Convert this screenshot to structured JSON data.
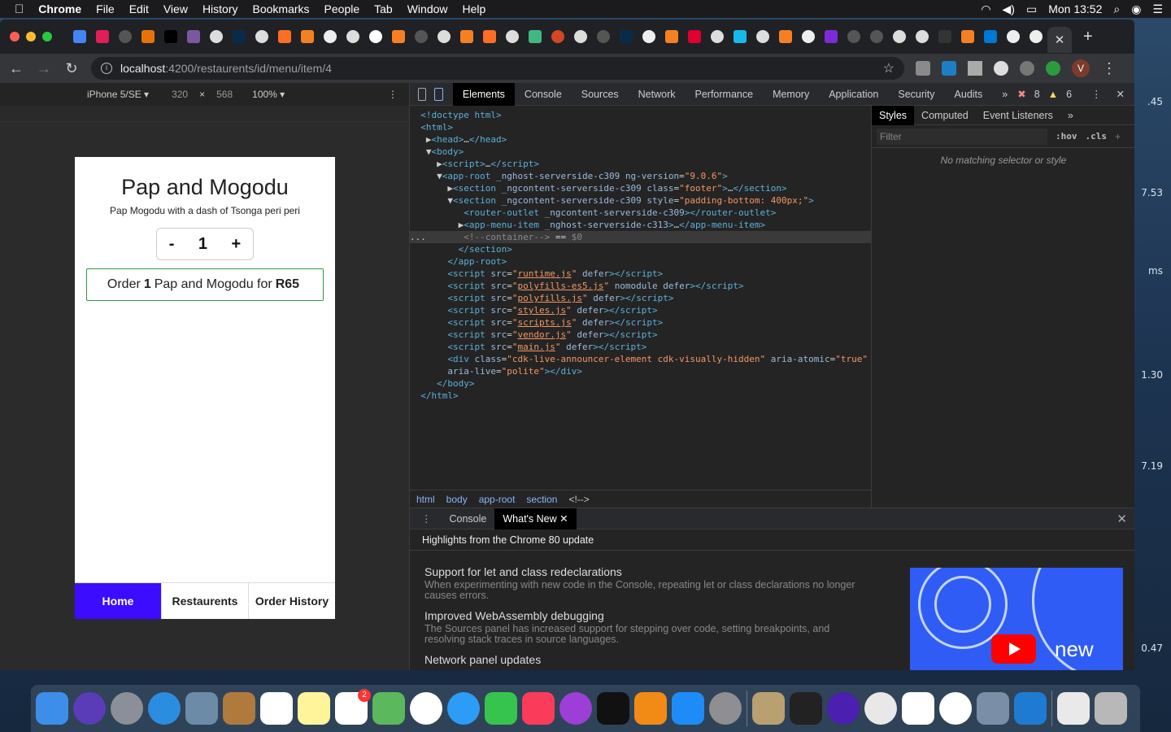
{
  "menubar": {
    "app": "Chrome",
    "menus": [
      "File",
      "Edit",
      "View",
      "History",
      "Bookmarks",
      "People",
      "Tab",
      "Window",
      "Help"
    ],
    "clock": "Mon 13:52"
  },
  "browser": {
    "url_host": "localhost",
    "url_path": ":4200/restaurents/id/menu/item/4",
    "avatar_initial": "V"
  },
  "device_toolbar": {
    "device": "iPhone 5/SE ▾",
    "width": "320",
    "times": "×",
    "height": "568",
    "zoom": "100% ▾"
  },
  "app": {
    "title": "Pap and Mogodu",
    "subtitle": "Pap Mogodu with a dash of Tsonga peri peri",
    "minus": "-",
    "quantity": "1",
    "plus": "+",
    "order_prefix": "Order",
    "order_qty": "1",
    "order_item": "Pap and Mogodu for",
    "order_price": "R65",
    "nav": {
      "home": "Home",
      "restaurants": "Restaurents",
      "history": "Order History"
    }
  },
  "devtools": {
    "tabs": [
      "Elements",
      "Console",
      "Sources",
      "Network",
      "Performance",
      "Memory",
      "Application",
      "Security",
      "Audits"
    ],
    "more": "»",
    "errors": "8",
    "warnings": "6",
    "styles_tabs": [
      "Styles",
      "Computed",
      "Event Listeners"
    ],
    "filter_placeholder": "Filter",
    "hov": ":hov",
    "cls": ".cls",
    "no_match": "No matching selector or style",
    "breadcrumbs": [
      "html",
      "body",
      "app-root",
      "section",
      "<!-->"
    ],
    "drawer_tabs": [
      "Console",
      "What's New"
    ],
    "highlights": "Highlights from the Chrome 80 update",
    "news": [
      {
        "title": "Support for let and class redeclarations",
        "body": "When experimenting with new code in the Console, repeating let or class declarations no longer causes errors."
      },
      {
        "title": "Improved WebAssembly debugging",
        "body": "The Sources panel has increased support for stepping over code, setting breakpoints, and resolving stack traces in source languages."
      },
      {
        "title": "Network panel updates",
        "body": ""
      }
    ],
    "promo_text": "new"
  },
  "desktop_numbers": [
    ".45",
    "7.53",
    "ms",
    "1.30",
    "7.19",
    "0.47"
  ]
}
